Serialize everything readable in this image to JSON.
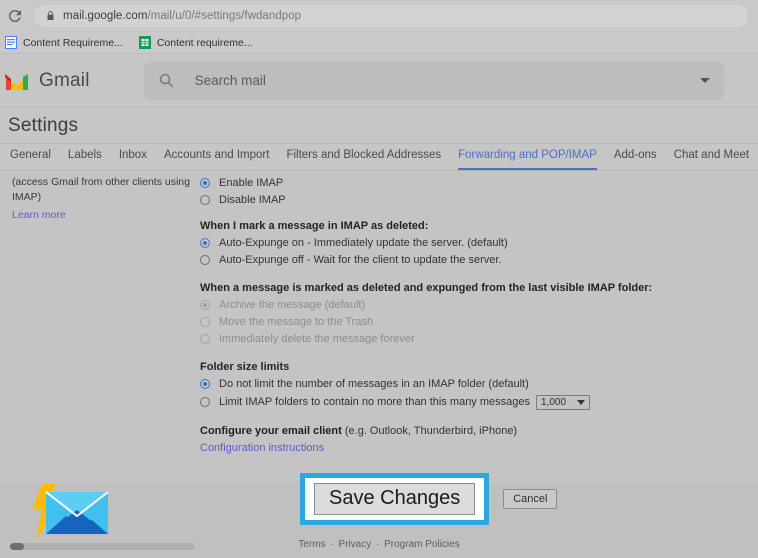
{
  "browser": {
    "reload_icon": "reload-icon",
    "lock_icon": "lock-icon",
    "url_prefix": "mail.google.com",
    "url_suffix": "/mail/u/0/#settings/fwdandpop",
    "bookmarks": [
      {
        "label": "Content Requireme...",
        "icon": "google-docs-icon",
        "color": "#4285f4"
      },
      {
        "label": "Content requireme...",
        "icon": "google-sheets-icon",
        "color": "#0f9d58"
      }
    ]
  },
  "gmail_header": {
    "logo_icon": "gmail-logo-icon",
    "wordmark": "Gmail",
    "search_icon": "search-icon",
    "search_placeholder": "Search mail",
    "search_caret_icon": "chevron-down-icon"
  },
  "settings": {
    "title": "Settings",
    "tabs": [
      {
        "label": "General",
        "active": false
      },
      {
        "label": "Labels",
        "active": false
      },
      {
        "label": "Inbox",
        "active": false
      },
      {
        "label": "Accounts and Import",
        "active": false
      },
      {
        "label": "Filters and Blocked Addresses",
        "active": false
      },
      {
        "label": "Forwarding and POP/IMAP",
        "active": true
      },
      {
        "label": "Add-ons",
        "active": false
      },
      {
        "label": "Chat and Meet",
        "active": false
      }
    ],
    "active_tab_color": "#4a6fc4"
  },
  "imap": {
    "left_note_line1": "(access Gmail from other clients using",
    "left_note_line2": "IMAP)",
    "learn_more": "Learn more",
    "enable_label": "Enable IMAP",
    "disable_label": "Disable IMAP",
    "enable_checked": true
  },
  "mark_deleted": {
    "heading": "When I mark a message in IMAP as deleted:",
    "option_on": "Auto-Expunge on - Immediately update the server. (default)",
    "option_off": "Auto-Expunge off - Wait for the client to update the server.",
    "on_checked": true
  },
  "expunged": {
    "heading": "When a message is marked as deleted and expunged from the last visible IMAP folder:",
    "option_archive": "Archive the message (default)",
    "option_trash": "Move the message to the Trash",
    "option_delete": "Immediately delete the message forever",
    "disabled": true
  },
  "folder_limits": {
    "heading": "Folder size limits",
    "option_nolimit": "Do not limit the number of messages in an IMAP folder (default)",
    "option_limit": "Limit IMAP folders to contain no more than this many messages",
    "select_value": "1,000",
    "select_caret_icon": "chevron-down-icon",
    "nolimit_checked": true
  },
  "configure": {
    "label_bold": "Configure your email client",
    "label_rest": " (e.g. Outlook, Thunderbird, iPhone)",
    "link": "Configuration instructions"
  },
  "actions": {
    "save_label": "Save Changes",
    "cancel_label": "Cancel",
    "highlight_color": "#2aa8e0"
  },
  "footer": {
    "terms": "Terms",
    "sep1": "·",
    "privacy": "Privacy",
    "sep2": "·",
    "policies": "Program Policies"
  },
  "watermark": {
    "icon": "envelope-lightning-icon"
  },
  "scrollbar": {
    "icon": "horizontal-scrollbar"
  }
}
